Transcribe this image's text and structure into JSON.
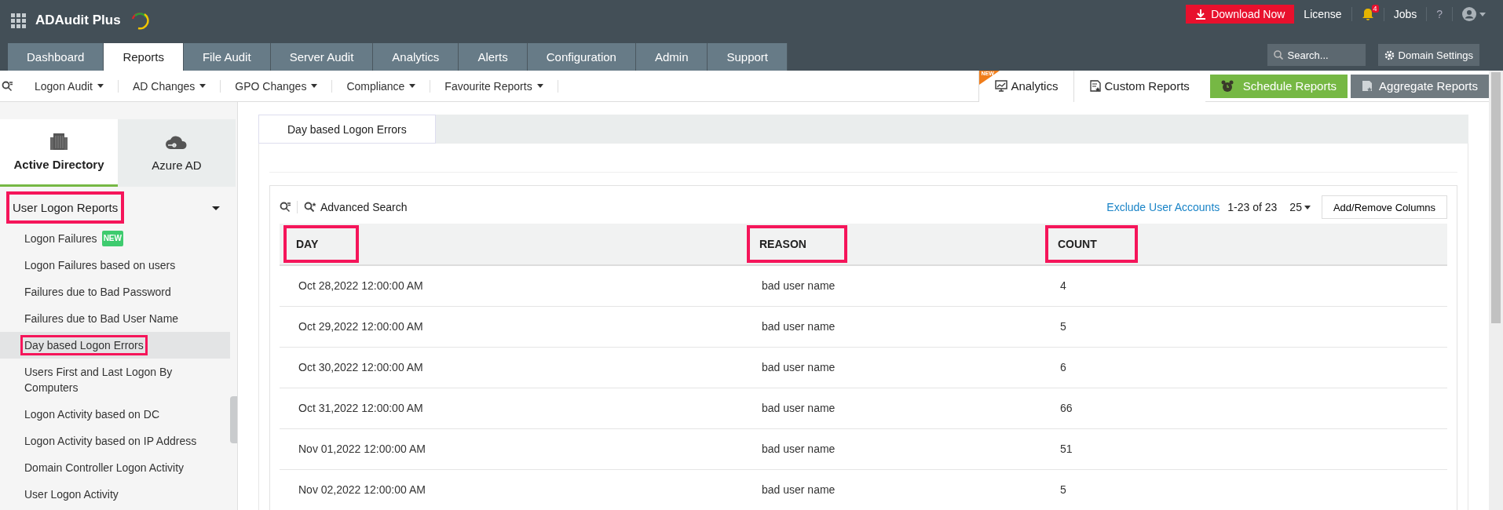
{
  "header": {
    "app_name": "ADAudit Plus",
    "download_button": "Download Now",
    "license": "License",
    "notification_count": "4",
    "jobs": "Jobs",
    "help": "?"
  },
  "nav_tabs": [
    {
      "label": "Dashboard",
      "selected": false
    },
    {
      "label": "Reports",
      "selected": true
    },
    {
      "label": "File Audit",
      "selected": false
    },
    {
      "label": "Server Audit",
      "selected": false
    },
    {
      "label": "Analytics",
      "selected": false
    },
    {
      "label": "Alerts",
      "selected": false
    },
    {
      "label": "Configuration",
      "selected": false
    },
    {
      "label": "Admin",
      "selected": false
    },
    {
      "label": "Support",
      "selected": false
    }
  ],
  "search": {
    "placeholder": "Search..."
  },
  "domain_settings": "Domain Settings",
  "toolbar": {
    "menus": [
      "Logon Audit",
      "AD Changes",
      "GPO Changes",
      "Compliance",
      "Favourite Reports"
    ],
    "analytics": {
      "label": "Analytics",
      "badge": "NEW"
    },
    "custom_reports": "Custom Reports",
    "schedule_reports": "Schedule Reports",
    "aggregate_reports": "Aggregate Reports"
  },
  "sidebar": {
    "tabs": [
      {
        "label": "Active Directory",
        "kind": "building",
        "selected": true
      },
      {
        "label": "Azure AD",
        "kind": "cloud",
        "selected": false
      }
    ],
    "group": {
      "title": "User Logon Reports",
      "expanded": true,
      "highlighted": true
    },
    "items": [
      {
        "label": "Logon Failures",
        "badge": "NEW",
        "selected": false,
        "highlighted": false
      },
      {
        "label": "Logon Failures based on users",
        "selected": false,
        "highlighted": false
      },
      {
        "label": "Failures due to Bad Password",
        "selected": false,
        "highlighted": false
      },
      {
        "label": "Failures due to Bad User Name",
        "selected": false,
        "highlighted": false
      },
      {
        "label": "Day based Logon Errors",
        "selected": true,
        "highlighted": true
      },
      {
        "label": "Users First and Last Logon By Computers",
        "selected": false,
        "highlighted": false
      },
      {
        "label": "Logon Activity based on DC",
        "selected": false,
        "highlighted": false
      },
      {
        "label": "Logon Activity based on IP Address",
        "selected": false,
        "highlighted": false
      },
      {
        "label": "Domain Controller Logon Activity",
        "selected": false,
        "highlighted": false
      },
      {
        "label": "User Logon Activity",
        "selected": false,
        "highlighted": false
      }
    ]
  },
  "report": {
    "tab": "Day based Logon Errors",
    "advanced_search": "Advanced Search",
    "exclude_link": "Exclude User Accounts",
    "range": "1-23 of 23",
    "page_size": "25",
    "add_remove_columns": "Add/Remove Columns",
    "table": {
      "columns": [
        {
          "label": "DAY",
          "highlighted": true
        },
        {
          "label": "REASON",
          "highlighted": true
        },
        {
          "label": "COUNT",
          "highlighted": true
        }
      ],
      "rows": [
        [
          "Oct 28,2022 12:00:00 AM",
          "bad user name",
          "4"
        ],
        [
          "Oct 29,2022 12:00:00 AM",
          "bad user name",
          "5"
        ],
        [
          "Oct 30,2022 12:00:00 AM",
          "bad user name",
          "6"
        ],
        [
          "Oct 31,2022 12:00:00 AM",
          "bad user name",
          "66"
        ],
        [
          "Nov 01,2022 12:00:00 AM",
          "bad user name",
          "51"
        ],
        [
          "Nov 02,2022 12:00:00 AM",
          "bad user name",
          "5"
        ]
      ]
    }
  }
}
